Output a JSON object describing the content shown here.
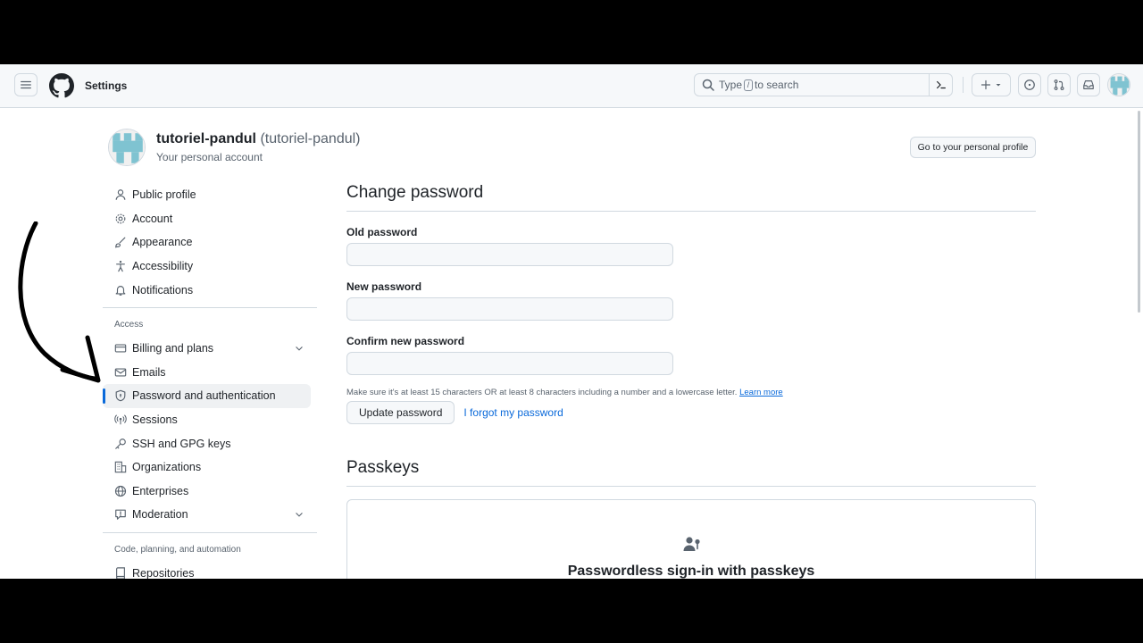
{
  "header": {
    "title": "Settings",
    "search_placeholder_before": "Type",
    "search_slash": "/",
    "search_placeholder_after": "to search"
  },
  "account": {
    "name": "tutoriel-pandul",
    "login": "(tutoriel-pandul)",
    "subtitle": "Your personal account",
    "profile_button": "Go to your personal profile"
  },
  "sidebar": {
    "items": [
      {
        "label": "Public profile",
        "icon": "person-icon"
      },
      {
        "label": "Account",
        "icon": "gear-icon"
      },
      {
        "label": "Appearance",
        "icon": "paintbrush-icon"
      },
      {
        "label": "Accessibility",
        "icon": "accessibility-icon"
      },
      {
        "label": "Notifications",
        "icon": "bell-icon"
      }
    ],
    "access_heading": "Access",
    "access_items": [
      {
        "label": "Billing and plans",
        "icon": "credit-card-icon"
      },
      {
        "label": "Emails",
        "icon": "mail-icon"
      },
      {
        "label": "Password and authentication",
        "icon": "shield-lock-icon"
      },
      {
        "label": "Sessions",
        "icon": "broadcast-icon"
      },
      {
        "label": "SSH and GPG keys",
        "icon": "key-icon"
      },
      {
        "label": "Organizations",
        "icon": "organization-icon"
      },
      {
        "label": "Enterprises",
        "icon": "globe-icon"
      },
      {
        "label": "Moderation",
        "icon": "report-icon"
      }
    ],
    "code_heading": "Code, planning, and automation",
    "code_items": [
      {
        "label": "Repositories",
        "icon": "repo-icon"
      }
    ],
    "active": "Password and authentication"
  },
  "change_password": {
    "title": "Change password",
    "old_label": "Old password",
    "new_label": "New password",
    "confirm_label": "Confirm new password",
    "note": "Make sure it's at least 15 characters OR at least 8 characters including a number and a lowercase letter.",
    "learn_more": "Learn more",
    "update_button": "Update password",
    "forgot_link": "I forgot my password"
  },
  "passkeys": {
    "title": "Passkeys",
    "heading": "Passwordless sign-in with passkeys"
  },
  "colors": {
    "accent": "#0969da",
    "border": "#d1d9e0",
    "muted": "#59636e"
  }
}
